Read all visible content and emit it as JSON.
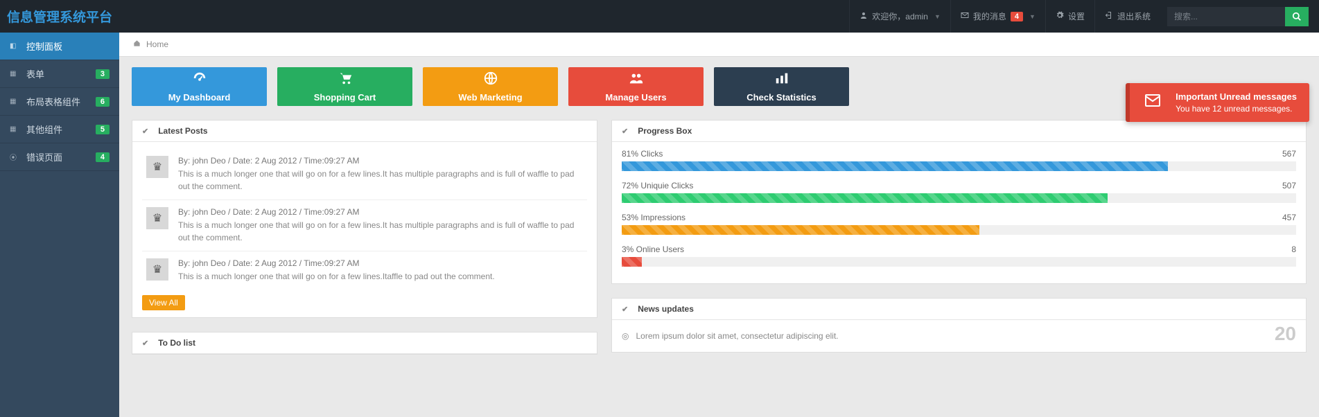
{
  "brand": "信息管理系统平台",
  "header": {
    "welcome_prefix": "欢迎你，",
    "welcome_user": "admin",
    "messages_label": "我的消息",
    "messages_badge": "4",
    "settings_label": "设置",
    "logout_label": "退出系统",
    "search_placeholder": "搜索..."
  },
  "sidebar": {
    "items": [
      {
        "label": "控制面板",
        "badge": "",
        "active": true
      },
      {
        "label": "表单",
        "badge": "3"
      },
      {
        "label": "布局表格组件",
        "badge": "6"
      },
      {
        "label": "其他组件",
        "badge": "5"
      },
      {
        "label": "错误页面",
        "badge": "4"
      }
    ]
  },
  "breadcrumb": {
    "home": "Home"
  },
  "tiles": [
    {
      "label": "My Dashboard",
      "cls": "tile-blue",
      "icon": "dashboard"
    },
    {
      "label": "Shopping Cart",
      "cls": "tile-green",
      "icon": "cart"
    },
    {
      "label": "Web Marketing",
      "cls": "tile-orange",
      "icon": "globe"
    },
    {
      "label": "Manage Users",
      "cls": "tile-red",
      "icon": "users"
    },
    {
      "label": "Check Statistics",
      "cls": "tile-darkblue",
      "icon": "stats"
    }
  ],
  "latest_posts": {
    "title": "Latest Posts",
    "view_all": "View All",
    "items": [
      {
        "meta": "By: john Deo / Date: 2 Aug 2012 / Time:09:27 AM",
        "text": "This is a much longer one that will go on for a few lines.It has multiple paragraphs and is full of waffle to pad out the comment."
      },
      {
        "meta": "By: john Deo / Date: 2 Aug 2012 / Time:09:27 AM",
        "text": "This is a much longer one that will go on for a few lines.It has multiple paragraphs and is full of waffle to pad out the comment."
      },
      {
        "meta": "By: john Deo / Date: 2 Aug 2012 / Time:09:27 AM",
        "text": "This is a much longer one that will go on for a few lines.Itaffle to pad out the comment."
      }
    ]
  },
  "progress": {
    "title": "Progress Box",
    "items": [
      {
        "label": "81% Clicks",
        "value": "567",
        "pct": 81,
        "cls": "pf-blue"
      },
      {
        "label": "72% Uniquie Clicks",
        "value": "507",
        "pct": 72,
        "cls": "pf-green"
      },
      {
        "label": "53% Impressions",
        "value": "457",
        "pct": 53,
        "cls": "pf-orange"
      },
      {
        "label": "3% Online Users",
        "value": "8",
        "pct": 3,
        "cls": "pf-red"
      }
    ]
  },
  "todo": {
    "title": "To Do list"
  },
  "news": {
    "title": "News updates",
    "count": "20",
    "items": [
      {
        "text": "Lorem ipsum dolor sit amet, consectetur adipiscing elit."
      }
    ]
  },
  "toast": {
    "title": "Important Unread messages",
    "text": "You have 12 unread messages."
  }
}
